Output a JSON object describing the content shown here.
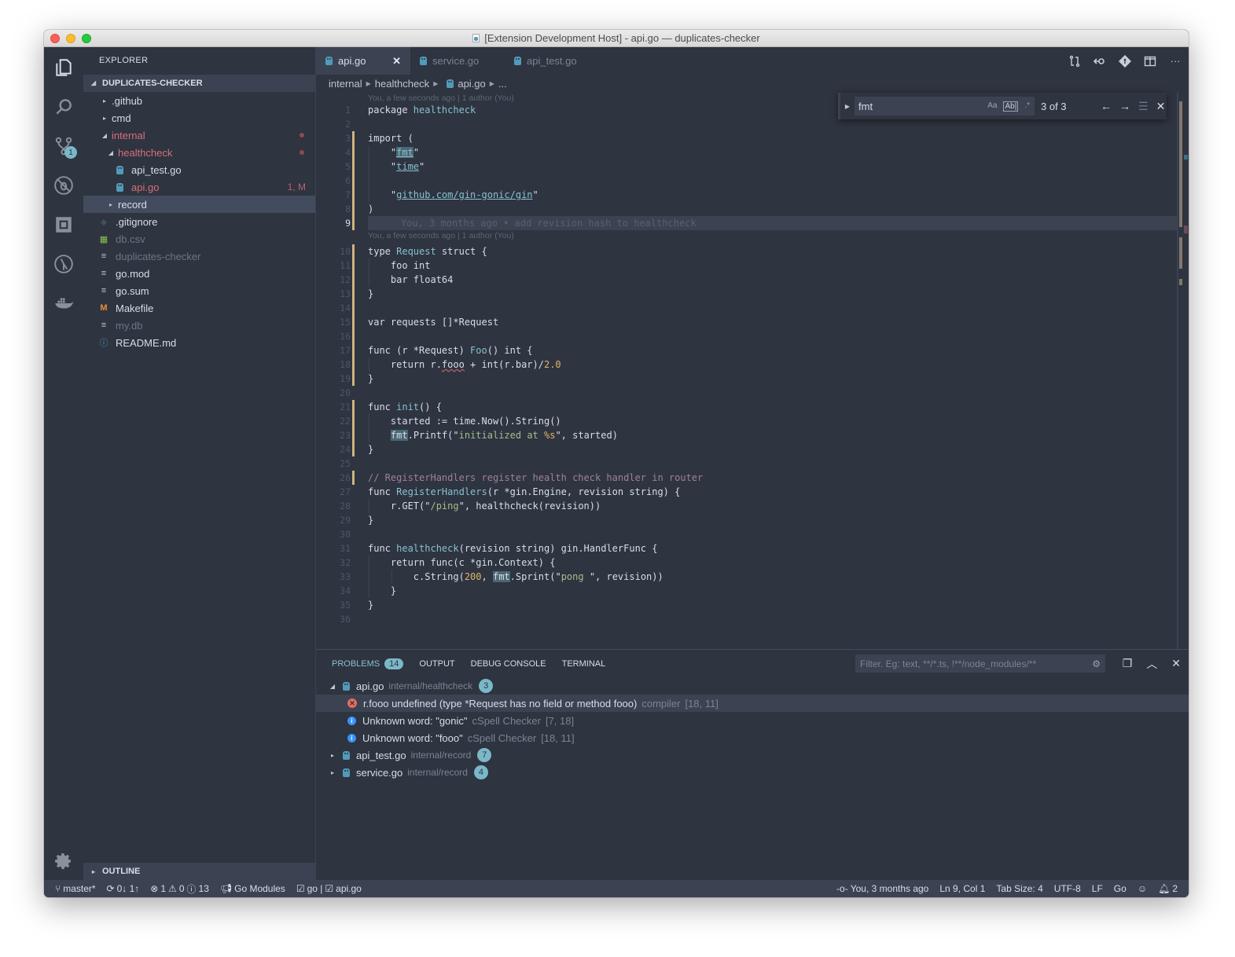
{
  "window": {
    "title": "[Extension Development Host] - api.go — duplicates-checker"
  },
  "activity_bar": {
    "items": [
      {
        "name": "explorer-icon"
      },
      {
        "name": "search-icon"
      },
      {
        "name": "source-control-icon",
        "badge": "1"
      },
      {
        "name": "debug-icon"
      },
      {
        "name": "extensions-icon"
      },
      {
        "name": "gitlens-icon"
      },
      {
        "name": "docker-icon"
      }
    ],
    "manage": "gear-icon"
  },
  "sidebar": {
    "title": "EXPLORER",
    "root": "DUPLICATES-CHECKER",
    "tree": [
      {
        "label": ".github",
        "type": "folder",
        "expanded": false,
        "depth": 1
      },
      {
        "label": "cmd",
        "type": "folder",
        "expanded": false,
        "depth": 1
      },
      {
        "label": "internal",
        "type": "folder",
        "expanded": true,
        "depth": 1,
        "modified": true
      },
      {
        "label": "healthcheck",
        "type": "folder",
        "expanded": true,
        "depth": 2,
        "modified": true
      },
      {
        "label": "api_test.go",
        "type": "go",
        "depth": 3
      },
      {
        "label": "api.go",
        "type": "go",
        "depth": 3,
        "modified": true,
        "decoration": "1, M"
      },
      {
        "label": "record",
        "type": "folder",
        "expanded": false,
        "depth": 2,
        "selected": true
      },
      {
        "label": ".gitignore",
        "type": "git",
        "depth": 1
      },
      {
        "label": "db.csv",
        "type": "csv",
        "depth": 1,
        "ignored": true
      },
      {
        "label": "duplicates-checker",
        "type": "text",
        "depth": 1,
        "ignored": true
      },
      {
        "label": "go.mod",
        "type": "text",
        "depth": 1
      },
      {
        "label": "go.sum",
        "type": "text",
        "depth": 1
      },
      {
        "label": "Makefile",
        "type": "make",
        "depth": 1
      },
      {
        "label": "my.db",
        "type": "text",
        "depth": 1,
        "ignored": true
      },
      {
        "label": "README.md",
        "type": "info",
        "depth": 1
      }
    ],
    "outline": "OUTLINE"
  },
  "tabs": [
    {
      "label": "api.go",
      "active": true
    },
    {
      "label": "service.go",
      "active": false
    },
    {
      "label": "api_test.go",
      "active": false
    }
  ],
  "breadcrumb": [
    "internal",
    "healthcheck",
    "api.go",
    "..."
  ],
  "find": {
    "value": "fmt",
    "match_case": "Aa",
    "whole_word": "Ab|",
    "regex": ".*",
    "count": "3 of 3"
  },
  "editor": {
    "codelens_1": "You, a few seconds ago | 1 author (You)",
    "codelens_2": "You, a few seconds ago | 1 author (You)",
    "blame_line_9": "You, 3 months ago • add revision hash to healthcheck",
    "current_line": 9,
    "lines": [
      "package healthcheck",
      "",
      "import (",
      "    \"fmt\"",
      "    \"time\"",
      "",
      "    \"github.com/gin-gonic/gin\"",
      ")",
      "",
      "type Request struct {",
      "    foo int",
      "    bar float64",
      "}",
      "",
      "var requests []*Request",
      "",
      "func (r *Request) Foo() int {",
      "    return r.fooo + int(r.bar)/2.0",
      "}",
      "",
      "func init() {",
      "    started := time.Now().String()",
      "    fmt.Printf(\"initialized at %s\", started)",
      "}",
      "",
      "// RegisterHandlers register health check handler in router",
      "func RegisterHandlers(r *gin.Engine, revision string) {",
      "    r.GET(\"/ping\", healthcheck(revision))",
      "}",
      "",
      "func healthcheck(revision string) gin.HandlerFunc {",
      "    return func(c *gin.Context) {",
      "        c.String(200, fmt.Sprint(\"pong \", revision))",
      "    }",
      "}",
      ""
    ]
  },
  "panel": {
    "tabs": [
      {
        "label": "PROBLEMS",
        "badge": "14",
        "active": true
      },
      {
        "label": "OUTPUT"
      },
      {
        "label": "DEBUG CONSOLE"
      },
      {
        "label": "TERMINAL"
      }
    ],
    "filter_placeholder": "Filter. Eg: text, **/*.ts, !**/node_modules/**",
    "groups": [
      {
        "file": "api.go",
        "path": "internal/healthcheck",
        "count": "3",
        "expanded": true,
        "items": [
          {
            "severity": "error",
            "message": "r.fooo undefined (type *Request has no field or method fooo)",
            "source": "compiler",
            "pos": "[18, 11]",
            "selected": true
          },
          {
            "severity": "info",
            "message": "Unknown word: \"gonic\"",
            "source": "cSpell Checker",
            "pos": "[7, 18]"
          },
          {
            "severity": "info",
            "message": "Unknown word: \"fooo\"",
            "source": "cSpell Checker",
            "pos": "[18, 11]"
          }
        ]
      },
      {
        "file": "api_test.go",
        "path": "internal/record",
        "count": "7",
        "expanded": false
      },
      {
        "file": "service.go",
        "path": "internal/record",
        "count": "4",
        "expanded": false
      }
    ]
  },
  "statusbar": {
    "branch": "master*",
    "sync": "0↓ 1↑",
    "errors": "1",
    "warnings": "0",
    "infos": "13",
    "go_modules": "Go Modules",
    "go_env": "go | ",
    "go_file": "api.go",
    "blame": "You, 3 months ago",
    "position": "Ln 9, Col 1",
    "tab_size": "Tab Size: 4",
    "encoding": "UTF-8",
    "eol": "LF",
    "language": "Go",
    "notifications": "2"
  }
}
